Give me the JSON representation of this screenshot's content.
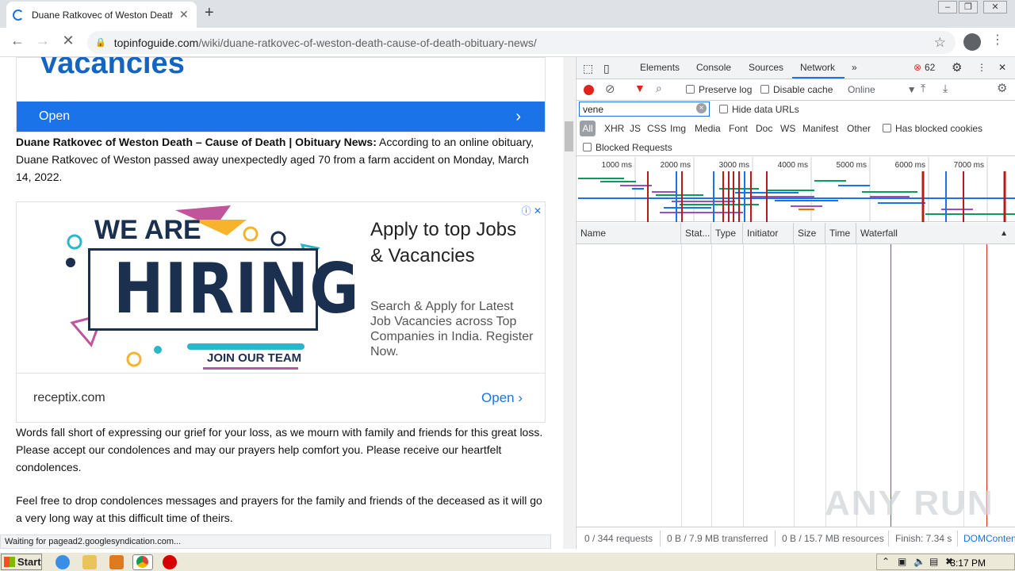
{
  "browser": {
    "tab_title": "Duane Ratkovec of Weston Death –",
    "url_domain": "topinfoguide.com",
    "url_path": "/wiki/duane-ratkovec-of-weston-death-cause-of-death-obituary-news/",
    "status_text": "Waiting for pagead2.googlesyndication.com..."
  },
  "page": {
    "topad_brand": "Vacancies",
    "topad_open": "Open",
    "intro_bold": "Duane Ratkovec of Weston Death – Cause of Death | Obituary News:",
    "intro_text": " According to an online obituary, Duane Ratkovec of Weston passed away unexpectedly aged 70 from a farm accident on Monday, March 14, 2022.",
    "ad": {
      "we_are": "WE ARE",
      "hiring": "HIRING",
      "join": "JOIN OUR TEAM",
      "headline": "Apply to top Jobs & Vacancies",
      "description": "Search & Apply for Latest Job Vacancies across Top Companies in India. Register Now.",
      "domain": "receptix.com",
      "open": "Open"
    },
    "para2": "Words fall short of expressing our grief for your loss, as we mourn with family and friends for this great loss. Please accept our condolences and may our prayers help comfort you. Please receive our heartfelt condolences.",
    "para3": "Feel free to drop condolences messages and prayers for the family and friends of the deceased as it will go a very long way at this difficult time of theirs."
  },
  "devtools": {
    "tabs": [
      "Elements",
      "Console",
      "Sources",
      "Network"
    ],
    "active_tab": "Network",
    "error_count": "62",
    "preserve_log": "Preserve log",
    "disable_cache": "Disable cache",
    "throttle": "Online",
    "filter_value": "vene",
    "hide_data_urls": "Hide data URLs",
    "types": [
      "All",
      "XHR",
      "JS",
      "CSS",
      "Img",
      "Media",
      "Font",
      "Doc",
      "WS",
      "Manifest",
      "Other"
    ],
    "has_blocked_cookies": "Has blocked cookies",
    "blocked_requests": "Blocked Requests",
    "timeline_ticks": [
      "1000 ms",
      "2000 ms",
      "3000 ms",
      "4000 ms",
      "5000 ms",
      "6000 ms",
      "7000 ms"
    ],
    "columns": [
      "Name",
      "Stat...",
      "Type",
      "Initiator",
      "Size",
      "Time",
      "Waterfall"
    ],
    "status": {
      "requests": "0 / 344 requests",
      "transferred": "0 B / 7.9 MB transferred",
      "resources": "0 B / 15.7 MB resources",
      "finish": "Finish: 7.34 s",
      "domcontent": "DOMConten"
    }
  },
  "watermark": "ANY RUN",
  "taskbar": {
    "start": "Start",
    "clock": "3:17 PM"
  },
  "colors": {
    "accent": "#1a73e8",
    "error": "#d93025",
    "record": "#e0241b"
  }
}
